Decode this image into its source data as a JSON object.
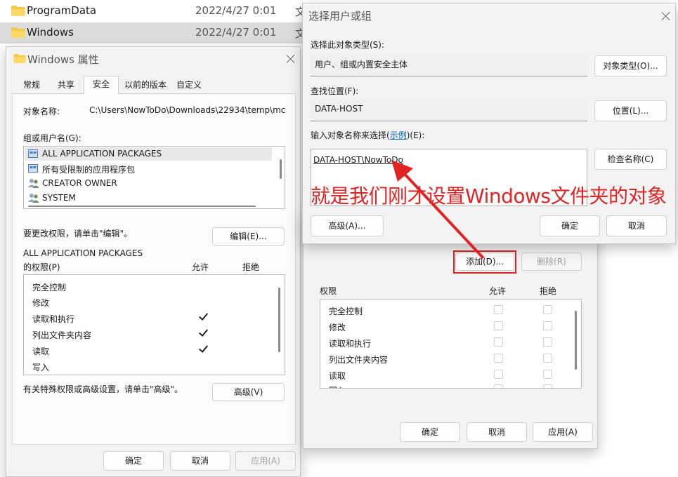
{
  "explorer": {
    "rows": [
      {
        "name": "ProgramData",
        "date": "2022/4/27 0:01",
        "type": "文"
      },
      {
        "name": "Windows",
        "date": "2022/4/27 0:01",
        "type": "文"
      }
    ]
  },
  "props": {
    "title": "Windows 属性",
    "tabs": [
      "常规",
      "共享",
      "安全",
      "以前的版本",
      "自定义"
    ],
    "object_label": "对象名称:",
    "object_value": "C:\\Users\\NowToDo\\Downloads\\22934\\temp\\mc",
    "group_label": "组或用户名(G):",
    "groups": [
      "ALL APPLICATION PACKAGES",
      "所有受限制的应用程序包",
      "CREATOR OWNER",
      "SYSTEM"
    ],
    "change_hint": "要更改权限，请单击\"编辑\"。",
    "edit_button": "编辑(E)...",
    "perm_for_line1": "ALL APPLICATION PACKAGES",
    "perm_for_line2": "的权限(P)",
    "allow": "允许",
    "deny": "拒绝",
    "perms": [
      "完全控制",
      "修改",
      "读取和执行",
      "列出文件夹内容",
      "读取",
      "写入"
    ],
    "perm_allowed": [
      false,
      false,
      true,
      true,
      true,
      false
    ],
    "adv_hint": "有关特殊权限或高级设置，请单击\"高级\"。",
    "adv_button": "高级(V)",
    "ok": "确定",
    "cancel": "取消",
    "apply": "应用(A)"
  },
  "perm_dialog": {
    "add_button": "添加(D)...",
    "remove_button": "删除(R)",
    "perm_header": "权限",
    "allow": "允许",
    "deny": "拒绝",
    "perms": [
      "完全控制",
      "修改",
      "读取和执行",
      "列出文件夹内容",
      "读取",
      "写入"
    ],
    "ok": "确定",
    "cancel": "取消",
    "apply": "应用(A)"
  },
  "select_dialog": {
    "title": "选择用户或组",
    "type_label": "选择此对象类型(S):",
    "type_value": "用户、组或内置安全主体",
    "type_button": "对象类型(O)...",
    "location_label": "查找位置(F):",
    "location_value": "DATA-HOST",
    "location_button": "位置(L)...",
    "name_label_pre": "输入对象名称来选择(",
    "name_label_link": "示例",
    "name_label_post": ")(E):",
    "name_value": "DATA-HOST\\NowToDo",
    "check_button": "检查名称(C)",
    "advanced_button": "高级(A)...",
    "ok": "确定",
    "cancel": "取消"
  },
  "annotation": {
    "text": "就是我们刚才设置Windows文件夹的对象",
    "color": "#e02424"
  },
  "colors": {
    "accent": "#0067c0",
    "highlight_border": "#e02424",
    "selected_row": "#dcdcdc"
  }
}
